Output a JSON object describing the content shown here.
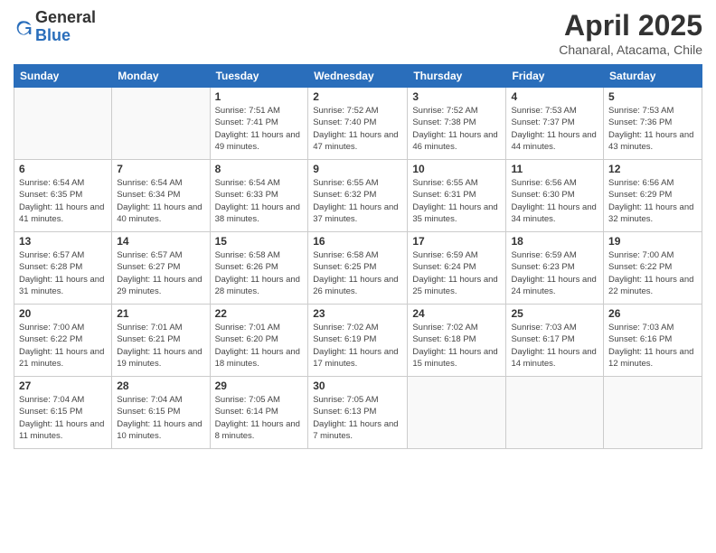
{
  "logo": {
    "general": "General",
    "blue": "Blue"
  },
  "header": {
    "title": "April 2025",
    "subtitle": "Chanaral, Atacama, Chile"
  },
  "weekdays": [
    "Sunday",
    "Monday",
    "Tuesday",
    "Wednesday",
    "Thursday",
    "Friday",
    "Saturday"
  ],
  "weeks": [
    [
      {
        "day": "",
        "empty": true
      },
      {
        "day": "",
        "empty": true
      },
      {
        "day": "1",
        "sunrise": "Sunrise: 7:51 AM",
        "sunset": "Sunset: 7:41 PM",
        "daylight": "Daylight: 11 hours and 49 minutes."
      },
      {
        "day": "2",
        "sunrise": "Sunrise: 7:52 AM",
        "sunset": "Sunset: 7:40 PM",
        "daylight": "Daylight: 11 hours and 47 minutes."
      },
      {
        "day": "3",
        "sunrise": "Sunrise: 7:52 AM",
        "sunset": "Sunset: 7:38 PM",
        "daylight": "Daylight: 11 hours and 46 minutes."
      },
      {
        "day": "4",
        "sunrise": "Sunrise: 7:53 AM",
        "sunset": "Sunset: 7:37 PM",
        "daylight": "Daylight: 11 hours and 44 minutes."
      },
      {
        "day": "5",
        "sunrise": "Sunrise: 7:53 AM",
        "sunset": "Sunset: 7:36 PM",
        "daylight": "Daylight: 11 hours and 43 minutes."
      }
    ],
    [
      {
        "day": "6",
        "sunrise": "Sunrise: 6:54 AM",
        "sunset": "Sunset: 6:35 PM",
        "daylight": "Daylight: 11 hours and 41 minutes."
      },
      {
        "day": "7",
        "sunrise": "Sunrise: 6:54 AM",
        "sunset": "Sunset: 6:34 PM",
        "daylight": "Daylight: 11 hours and 40 minutes."
      },
      {
        "day": "8",
        "sunrise": "Sunrise: 6:54 AM",
        "sunset": "Sunset: 6:33 PM",
        "daylight": "Daylight: 11 hours and 38 minutes."
      },
      {
        "day": "9",
        "sunrise": "Sunrise: 6:55 AM",
        "sunset": "Sunset: 6:32 PM",
        "daylight": "Daylight: 11 hours and 37 minutes."
      },
      {
        "day": "10",
        "sunrise": "Sunrise: 6:55 AM",
        "sunset": "Sunset: 6:31 PM",
        "daylight": "Daylight: 11 hours and 35 minutes."
      },
      {
        "day": "11",
        "sunrise": "Sunrise: 6:56 AM",
        "sunset": "Sunset: 6:30 PM",
        "daylight": "Daylight: 11 hours and 34 minutes."
      },
      {
        "day": "12",
        "sunrise": "Sunrise: 6:56 AM",
        "sunset": "Sunset: 6:29 PM",
        "daylight": "Daylight: 11 hours and 32 minutes."
      }
    ],
    [
      {
        "day": "13",
        "sunrise": "Sunrise: 6:57 AM",
        "sunset": "Sunset: 6:28 PM",
        "daylight": "Daylight: 11 hours and 31 minutes."
      },
      {
        "day": "14",
        "sunrise": "Sunrise: 6:57 AM",
        "sunset": "Sunset: 6:27 PM",
        "daylight": "Daylight: 11 hours and 29 minutes."
      },
      {
        "day": "15",
        "sunrise": "Sunrise: 6:58 AM",
        "sunset": "Sunset: 6:26 PM",
        "daylight": "Daylight: 11 hours and 28 minutes."
      },
      {
        "day": "16",
        "sunrise": "Sunrise: 6:58 AM",
        "sunset": "Sunset: 6:25 PM",
        "daylight": "Daylight: 11 hours and 26 minutes."
      },
      {
        "day": "17",
        "sunrise": "Sunrise: 6:59 AM",
        "sunset": "Sunset: 6:24 PM",
        "daylight": "Daylight: 11 hours and 25 minutes."
      },
      {
        "day": "18",
        "sunrise": "Sunrise: 6:59 AM",
        "sunset": "Sunset: 6:23 PM",
        "daylight": "Daylight: 11 hours and 24 minutes."
      },
      {
        "day": "19",
        "sunrise": "Sunrise: 7:00 AM",
        "sunset": "Sunset: 6:22 PM",
        "daylight": "Daylight: 11 hours and 22 minutes."
      }
    ],
    [
      {
        "day": "20",
        "sunrise": "Sunrise: 7:00 AM",
        "sunset": "Sunset: 6:22 PM",
        "daylight": "Daylight: 11 hours and 21 minutes."
      },
      {
        "day": "21",
        "sunrise": "Sunrise: 7:01 AM",
        "sunset": "Sunset: 6:21 PM",
        "daylight": "Daylight: 11 hours and 19 minutes."
      },
      {
        "day": "22",
        "sunrise": "Sunrise: 7:01 AM",
        "sunset": "Sunset: 6:20 PM",
        "daylight": "Daylight: 11 hours and 18 minutes."
      },
      {
        "day": "23",
        "sunrise": "Sunrise: 7:02 AM",
        "sunset": "Sunset: 6:19 PM",
        "daylight": "Daylight: 11 hours and 17 minutes."
      },
      {
        "day": "24",
        "sunrise": "Sunrise: 7:02 AM",
        "sunset": "Sunset: 6:18 PM",
        "daylight": "Daylight: 11 hours and 15 minutes."
      },
      {
        "day": "25",
        "sunrise": "Sunrise: 7:03 AM",
        "sunset": "Sunset: 6:17 PM",
        "daylight": "Daylight: 11 hours and 14 minutes."
      },
      {
        "day": "26",
        "sunrise": "Sunrise: 7:03 AM",
        "sunset": "Sunset: 6:16 PM",
        "daylight": "Daylight: 11 hours and 12 minutes."
      }
    ],
    [
      {
        "day": "27",
        "sunrise": "Sunrise: 7:04 AM",
        "sunset": "Sunset: 6:15 PM",
        "daylight": "Daylight: 11 hours and 11 minutes."
      },
      {
        "day": "28",
        "sunrise": "Sunrise: 7:04 AM",
        "sunset": "Sunset: 6:15 PM",
        "daylight": "Daylight: 11 hours and 10 minutes."
      },
      {
        "day": "29",
        "sunrise": "Sunrise: 7:05 AM",
        "sunset": "Sunset: 6:14 PM",
        "daylight": "Daylight: 11 hours and 8 minutes."
      },
      {
        "day": "30",
        "sunrise": "Sunrise: 7:05 AM",
        "sunset": "Sunset: 6:13 PM",
        "daylight": "Daylight: 11 hours and 7 minutes."
      },
      {
        "day": "",
        "empty": true
      },
      {
        "day": "",
        "empty": true
      },
      {
        "day": "",
        "empty": true
      }
    ]
  ]
}
